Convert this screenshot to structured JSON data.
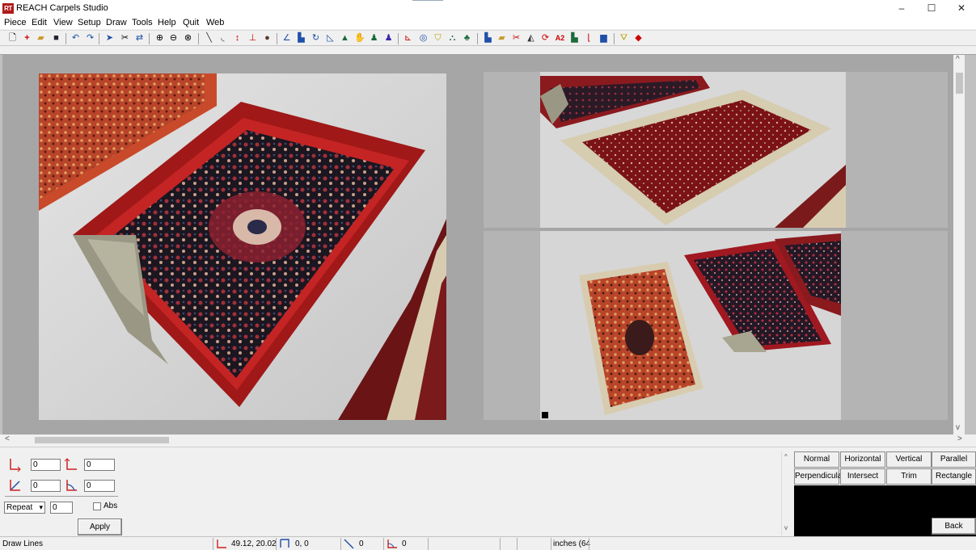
{
  "window": {
    "title": "REACH Carpels Studio",
    "app_icon_text": "RT",
    "minimize_glyph": "–",
    "maximize_glyph": "☐",
    "close_glyph": "✕"
  },
  "menu": [
    {
      "label": "Piece"
    },
    {
      "label": "Edit"
    },
    {
      "label": "View"
    },
    {
      "label": "Setup"
    },
    {
      "label": "Draw"
    },
    {
      "label": "Tools"
    },
    {
      "label": "Help"
    },
    {
      "label": "Quit"
    },
    {
      "label": "Web"
    }
  ],
  "toolbar_icons": [
    "new-file-icon",
    "add-icon",
    "open-folder-icon",
    "save-icon",
    "undo-icon",
    "redo-icon",
    "select-arrow-icon",
    "cut-icon",
    "move-icon",
    "zoom-in-icon",
    "zoom-out-icon",
    "zoom-fit-icon",
    "line-icon",
    "arc-icon",
    "vertical-dimension-icon",
    "horizontal-dimension-icon",
    "circle-marker-icon",
    "angle-icon",
    "piece-icon",
    "rotate-icon",
    "ruler-icon",
    "triangle-icon",
    "hand-icon",
    "person-icon",
    "person-blue-icon",
    "shape-icon",
    "target-icon",
    "shield-icon",
    "binoculars-icon",
    "tree-icon",
    "cabinet-icon",
    "folder-icon",
    "scissors-icon",
    "split-icon",
    "refresh-icon",
    "text-a2-icon",
    "flag-icon",
    "vertical-text-icon",
    "print-icon",
    "trophy-icon",
    "export-icon"
  ],
  "canvas": {
    "photos": [
      {
        "name": "carpet-photo-main",
        "description": "Persian carpet with folded corner"
      },
      {
        "name": "carpet-photo-top-right",
        "description": "Red carpet with border"
      },
      {
        "name": "carpet-photo-bottom-right",
        "description": "Three carpets on floor"
      }
    ],
    "scroll_left_glyph": "<",
    "scroll_right_glyph": ">",
    "scroll_up_glyph": "^",
    "scroll_down_glyph": "v"
  },
  "inputs": {
    "x_offset": "0",
    "y_offset": "0",
    "length": "0",
    "angle": "0",
    "repeat_count": "0"
  },
  "repeat": {
    "selected": "Repeat",
    "arrow": "▾"
  },
  "abs_label": "Abs",
  "apply_label": "Apply",
  "draw_modes": [
    {
      "label": "Normal"
    },
    {
      "label": "Horizontal"
    },
    {
      "label": "Vertical"
    },
    {
      "label": "Parallel"
    },
    {
      "label": "Perpendicular"
    },
    {
      "label": "Intersect"
    },
    {
      "label": "Trim"
    },
    {
      "label": "Rectangle"
    }
  ],
  "back_label": "Back",
  "status": {
    "mode": "Draw Lines",
    "cursor_position": "49.12,  20.02",
    "delta": "0, 0",
    "length": "0",
    "angle": "0",
    "units": "inches (64"
  },
  "colors": {
    "accent_red": "#cc1a1a",
    "accent_blue": "#1f4fa8",
    "canvas_gray": "#a6a6a6"
  }
}
